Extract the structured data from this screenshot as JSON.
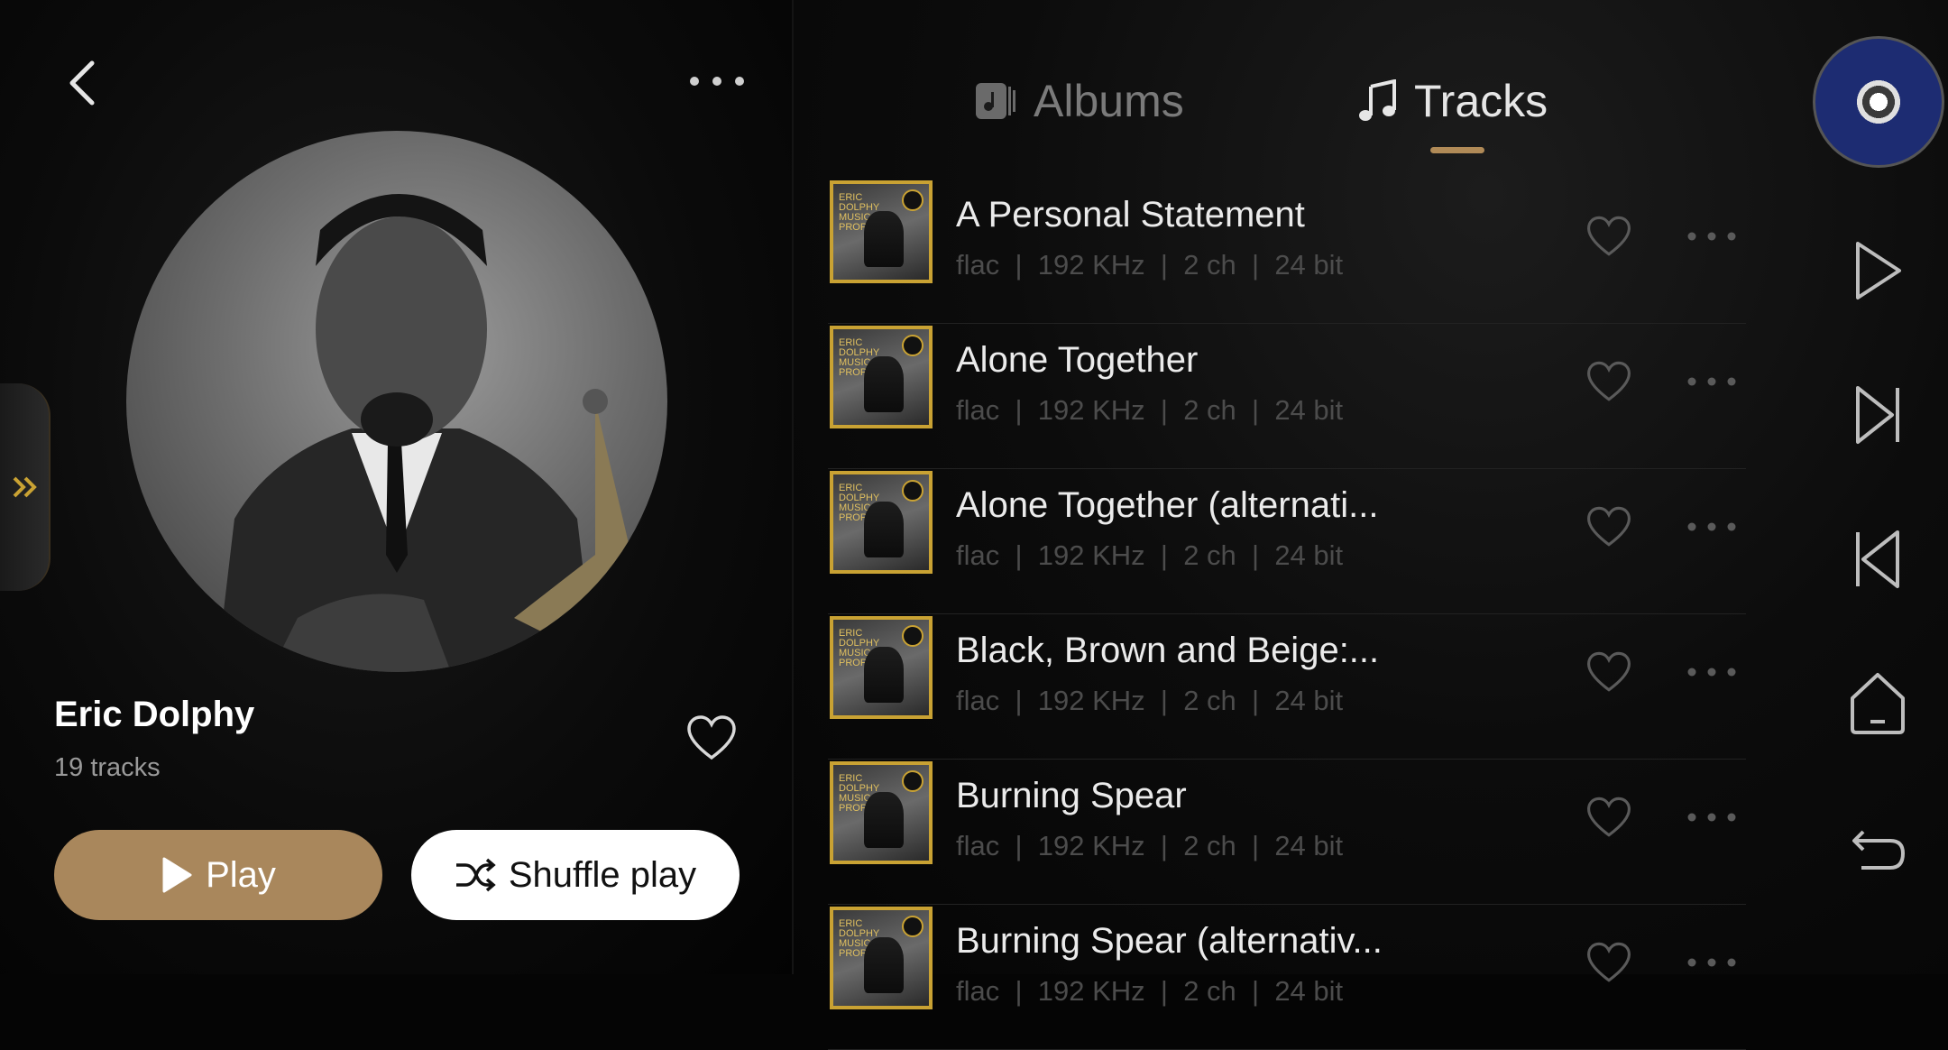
{
  "artist": {
    "name": "Eric Dolphy",
    "track_count": "19 tracks"
  },
  "buttons": {
    "play": "Play",
    "shuffle": "Shuffle play"
  },
  "tabs": [
    {
      "label": "Albums",
      "icon": "album-icon",
      "active": false
    },
    {
      "label": "Tracks",
      "icon": "music-note-icon",
      "active": true
    }
  ],
  "tracks": [
    {
      "title": "A Personal Statement",
      "format": "flac",
      "rate": "192 KHz",
      "channels": "2 ch",
      "depth": "24 bit"
    },
    {
      "title": "Alone Together",
      "format": "flac",
      "rate": "192 KHz",
      "channels": "2 ch",
      "depth": "24 bit"
    },
    {
      "title": "Alone Together (alternati...",
      "format": "flac",
      "rate": "192 KHz",
      "channels": "2 ch",
      "depth": "24 bit"
    },
    {
      "title": "Black, Brown and Beige:...",
      "format": "flac",
      "rate": "192 KHz",
      "channels": "2 ch",
      "depth": "24 bit"
    },
    {
      "title": "Burning Spear",
      "format": "flac",
      "rate": "192 KHz",
      "channels": "2 ch",
      "depth": "24 bit"
    },
    {
      "title": "Burning Spear (alternativ...",
      "format": "flac",
      "rate": "192 KHz",
      "channels": "2 ch",
      "depth": "24 bit"
    }
  ],
  "album_cover": {
    "lines": [
      "ERIC",
      "DOLPHY",
      "MUSICAL",
      "PROPHET"
    ]
  },
  "colors": {
    "accent": "#b08a57",
    "play_button": "#a9875c",
    "cover_border": "#c9a233",
    "meta_text": "#4c4c4c"
  },
  "controls": [
    "play-icon",
    "next-icon",
    "previous-icon",
    "home-icon",
    "return-icon"
  ]
}
